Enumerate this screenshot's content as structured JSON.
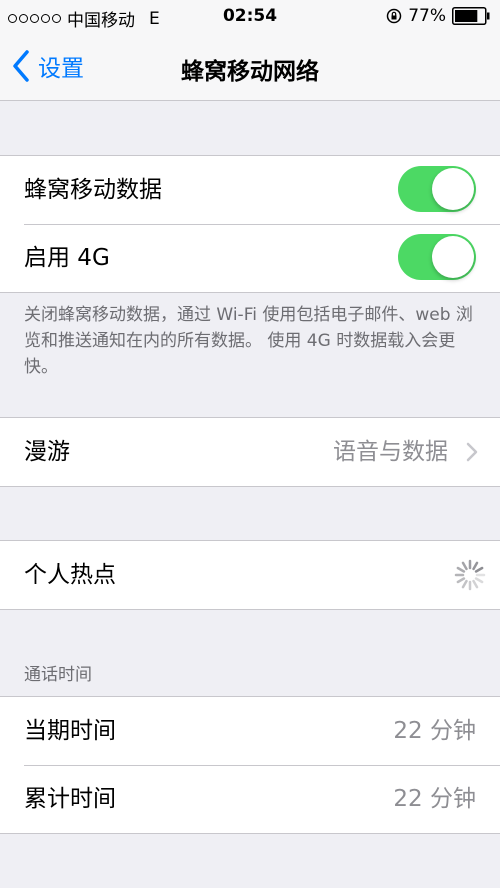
{
  "status_bar": {
    "carrier": "中国移动",
    "network": "E",
    "time": "02:54",
    "battery": "77%",
    "signal_icon": "signal-dots-icon",
    "lock_icon": "rotation-lock-icon",
    "battery_icon": "battery-icon"
  },
  "nav": {
    "back_label": "设置",
    "title": "蜂窝移动网络"
  },
  "cellular": {
    "data_label": "蜂窝移动数据",
    "data_on": true,
    "lte_label": "启用 4G",
    "lte_on": true,
    "footer": "关闭蜂窝移动数据，通过 Wi-Fi 使用包括电子邮件、web 浏览和推送通知在内的所有数据。 使用 4G 时数据载入会更快。"
  },
  "roaming": {
    "label": "漫游",
    "value": "语音与数据"
  },
  "hotspot": {
    "label": "个人热点"
  },
  "call_time": {
    "header": "通话时间",
    "rows": [
      {
        "label": "当期时间",
        "value": "22 分钟"
      },
      {
        "label": "累计时间",
        "value": "22 分钟"
      }
    ]
  },
  "colors": {
    "accent": "#007aff",
    "toggle_on": "#4cd964",
    "background": "#efeff4"
  }
}
